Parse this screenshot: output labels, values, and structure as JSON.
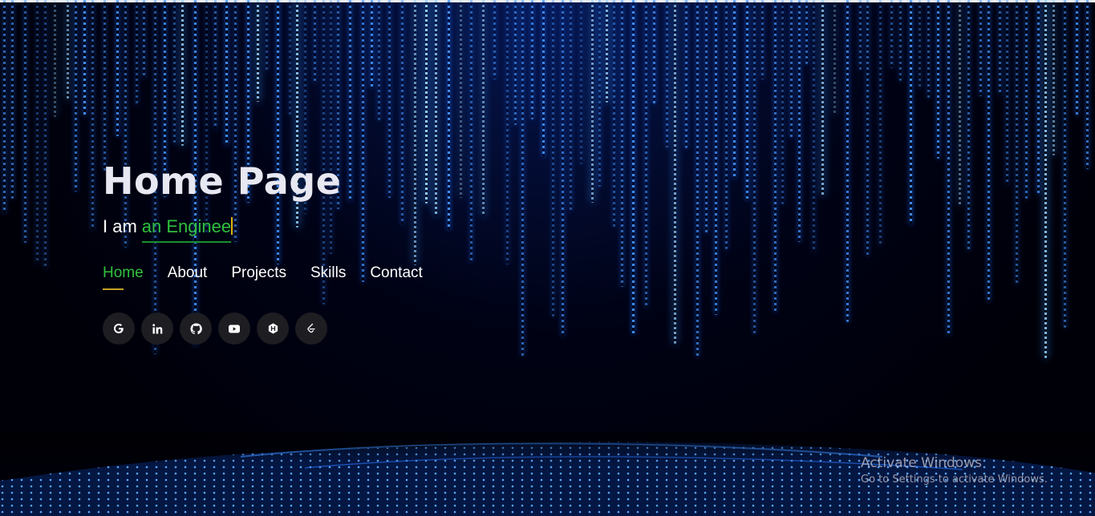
{
  "hero": {
    "title": "Home Page",
    "intro_prefix": "I am",
    "intro_role": "an Enginee"
  },
  "nav": {
    "items": [
      {
        "label": "Home",
        "active": true
      },
      {
        "label": "About",
        "active": false
      },
      {
        "label": "Projects",
        "active": false
      },
      {
        "label": "Skills",
        "active": false
      },
      {
        "label": "Contact",
        "active": false
      }
    ]
  },
  "socials": [
    {
      "icon": "google-icon"
    },
    {
      "icon": "linkedin-icon"
    },
    {
      "icon": "github-icon"
    },
    {
      "icon": "youtube-icon"
    },
    {
      "icon": "hackerrank-icon"
    },
    {
      "icon": "leetcode-icon"
    }
  ],
  "watermark": {
    "title": "Activate Windows",
    "subtitle": "Go to Settings to activate Windows."
  },
  "colors": {
    "accent_green": "#2fc13e",
    "underline_gold": "#c9a227",
    "title_text": "#e8e8f2",
    "background": "#000008",
    "rain_blue": "#4696ff"
  }
}
